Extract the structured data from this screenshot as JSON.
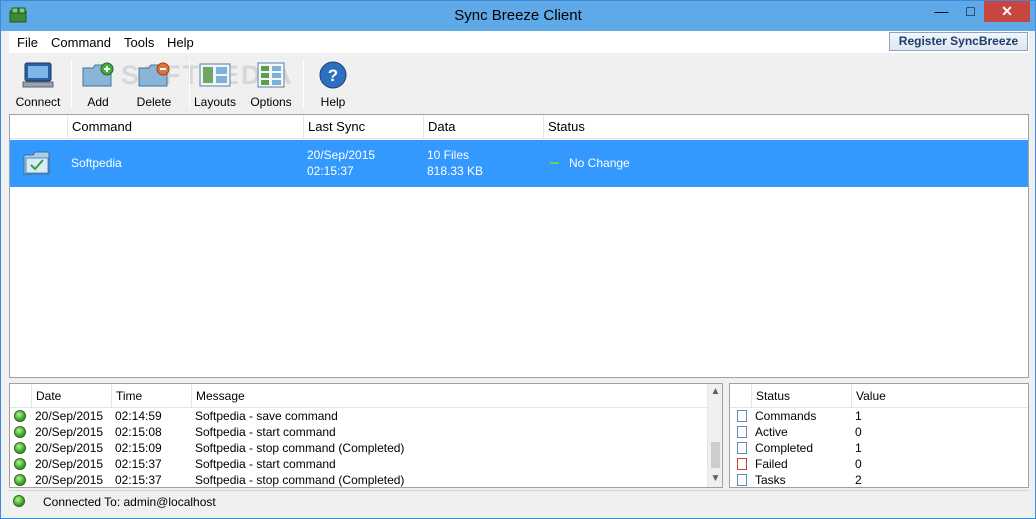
{
  "window": {
    "title": "Sync Breeze Client"
  },
  "menu": {
    "items": [
      "File",
      "Command",
      "Tools",
      "Help"
    ],
    "register_label": "Register SyncBreeze"
  },
  "toolbar": {
    "watermark": "SOFTPEDIA",
    "buttons": [
      {
        "label": "Connect",
        "icon": "computer-icon"
      },
      {
        "label": "Add",
        "icon": "folder-add-icon"
      },
      {
        "label": "Delete",
        "icon": "folder-delete-icon"
      },
      {
        "label": "Layouts",
        "icon": "layouts-icon"
      },
      {
        "label": "Options",
        "icon": "options-icon"
      },
      {
        "label": "Help",
        "icon": "help-icon"
      }
    ]
  },
  "commands": {
    "headers": [
      "Command",
      "Last Sync",
      "Data",
      "Status"
    ],
    "rows": [
      {
        "name": "Softpedia",
        "last_sync_date": "20/Sep/2015",
        "last_sync_time": "02:15:37",
        "data_files": "10 Files",
        "data_size": "818.33 KB",
        "status": "No Change"
      }
    ]
  },
  "log": {
    "headers": [
      "Date",
      "Time",
      "Message"
    ],
    "rows": [
      {
        "date": "20/Sep/2015",
        "time": "02:14:59",
        "message": "Softpedia - save command"
      },
      {
        "date": "20/Sep/2015",
        "time": "02:15:08",
        "message": "Softpedia - start command"
      },
      {
        "date": "20/Sep/2015",
        "time": "02:15:09",
        "message": "Softpedia - stop command (Completed)"
      },
      {
        "date": "20/Sep/2015",
        "time": "02:15:37",
        "message": "Softpedia - start command"
      },
      {
        "date": "20/Sep/2015",
        "time": "02:15:37",
        "message": "Softpedia - stop command (Completed)"
      }
    ]
  },
  "stats": {
    "headers": [
      "Status",
      "Value"
    ],
    "rows": [
      {
        "label": "Commands",
        "value": "1"
      },
      {
        "label": "Active",
        "value": "0"
      },
      {
        "label": "Completed",
        "value": "1"
      },
      {
        "label": "Failed",
        "value": "0"
      },
      {
        "label": "Tasks",
        "value": "2"
      }
    ]
  },
  "statusbar": {
    "text": "Connected To: admin@localhost"
  },
  "colors": {
    "titlebar": "#5fa9e9",
    "selection": "#3399ff",
    "close": "#c7463f"
  }
}
